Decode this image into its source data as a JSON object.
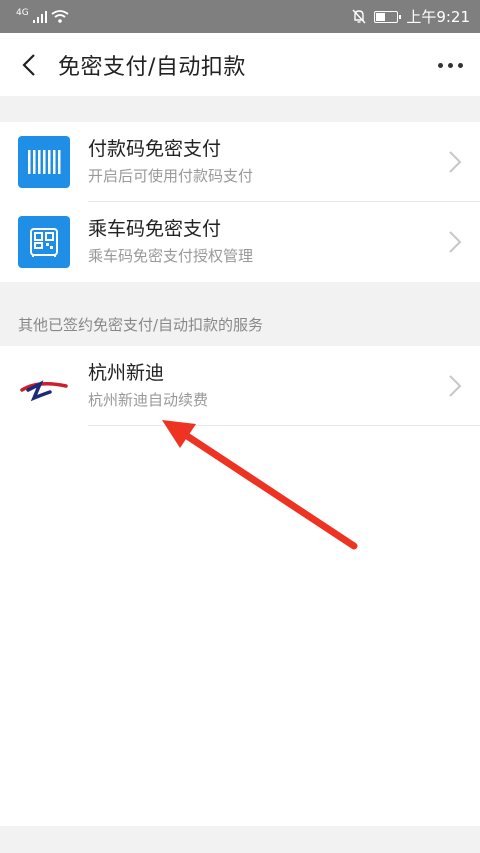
{
  "status_bar": {
    "network": "4G",
    "time": "上午9:21",
    "icons": [
      "signal-icon",
      "wifi-icon",
      "mute-icon",
      "battery-icon"
    ]
  },
  "header": {
    "title": "免密支付/自动扣款",
    "back_icon": "back-arrow-icon",
    "more_icon": "more-dots-icon"
  },
  "services": [
    {
      "title": "付款码免密支付",
      "subtitle": "开启后可使用付款码支付",
      "icon": "barcode-icon"
    },
    {
      "title": "乘车码免密支付",
      "subtitle": "乘车码免密支付授权管理",
      "icon": "transit-qr-icon"
    }
  ],
  "other_section": {
    "label": "其他已签约免密支付/自动扣款的服务",
    "items": [
      {
        "title": "杭州新迪",
        "subtitle": "杭州新迪自动续费",
        "icon": "merchant-logo-icon"
      }
    ]
  },
  "colors": {
    "accent": "#1e8ee6",
    "status_bar": "#7f7f7f",
    "section_bg": "#f2f2f2",
    "annotation_arrow": "#ee3322"
  }
}
